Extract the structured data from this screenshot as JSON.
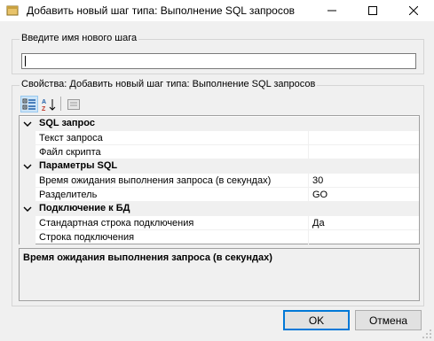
{
  "window": {
    "title": "Добавить новый шаг типа: Выполнение SQL запросов"
  },
  "name_group": {
    "legend": "Введите имя нового шага",
    "input_value": ""
  },
  "properties_group": {
    "legend": "Свойства: Добавить новый шаг типа: Выполнение SQL запросов",
    "toolbar": {
      "categorized_icon": "categorized-icon",
      "alphabetical_icon": "alphabetical-icon",
      "property_pages_icon": "property-pages-icon"
    },
    "categories": [
      {
        "label": "SQL запрос",
        "properties": [
          {
            "name": "Текст запроса",
            "value": ""
          },
          {
            "name": "Файл скрипта",
            "value": ""
          }
        ]
      },
      {
        "label": "Параметры SQL",
        "properties": [
          {
            "name": "Время ожидания выполнения запроса (в секундах)",
            "value": "30"
          },
          {
            "name": "Разделитель",
            "value": "GO"
          }
        ]
      },
      {
        "label": "Подключение к БД",
        "properties": [
          {
            "name": "Стандартная строка подключения",
            "value": "Да"
          },
          {
            "name": "Строка подключения",
            "value": ""
          }
        ]
      }
    ],
    "description_title": "Время ожидания выполнения запроса (в секундах)"
  },
  "buttons": {
    "ok": "OK",
    "cancel": "Отмена"
  }
}
